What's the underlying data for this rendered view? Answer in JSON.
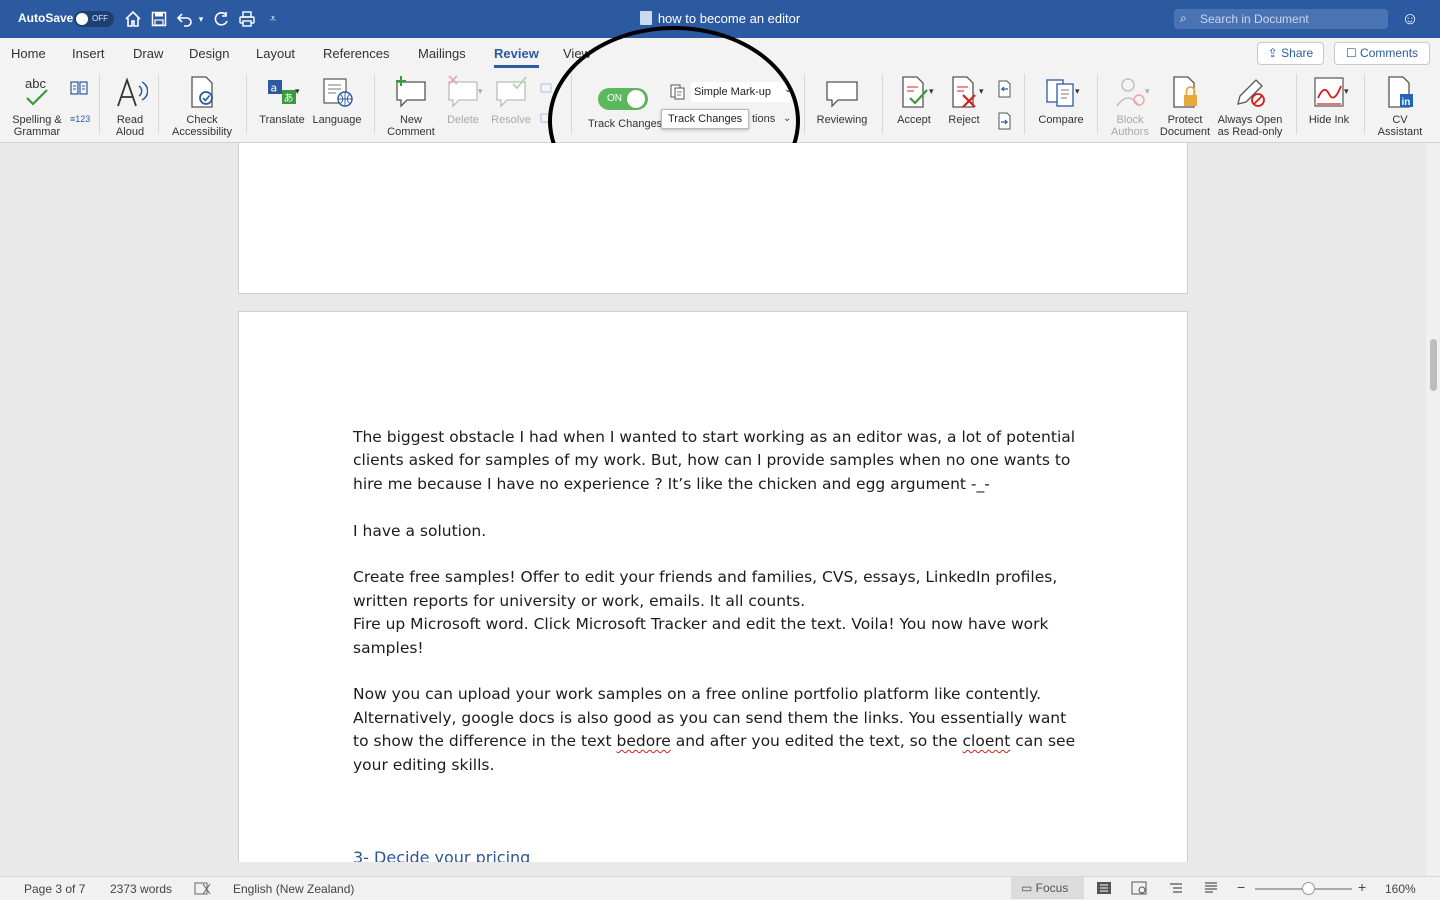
{
  "titlebar": {
    "autosave_label": "AutoSave",
    "autosave_state": "OFF",
    "document_title": "how to become an editor",
    "search_placeholder": "Search in Document"
  },
  "tabs": [
    "Home",
    "Insert",
    "Draw",
    "Design",
    "Layout",
    "References",
    "Mailings",
    "Review",
    "View"
  ],
  "active_tab": "Review",
  "share_label": "Share",
  "comments_label": "Comments",
  "ribbon": {
    "spelling": "Spelling &",
    "spelling2": "Grammar",
    "read": "Read",
    "read2": "Aloud",
    "check": "Check",
    "check2": "Accessibility",
    "translate": "Translate",
    "language": "Language",
    "new": "New",
    "new2": "Comment",
    "delete": "Delete",
    "resolve": "Resolve",
    "track_on": "ON",
    "track_label": "Track Changes",
    "markup_value": "Simple Mark-up",
    "options_fragment": "tions",
    "tooltip": "Track Changes",
    "reviewing": "Reviewing",
    "accept": "Accept",
    "reject": "Reject",
    "compare": "Compare",
    "block": "Block",
    "block2": "Authors",
    "protect": "Protect",
    "protect2": "Document",
    "always": "Always Open",
    "always2": "as Read-only",
    "hide_ink": "Hide Ink",
    "cv": "CV",
    "cv2": "Assistant"
  },
  "document": {
    "paragraphs": [
      "The biggest obstacle I had when I wanted to start working as an editor was, a lot of potential clients asked for samples of my work. But, how can I provide samples when no one wants to hire me because I have no experience ? It’s like the chicken and egg argument -_-",
      "",
      "I have a solution.",
      "",
      "Create free samples! Offer to edit your friends and families, CVS, essays, LinkedIn profiles, written reports for university or work, emails. It all counts.",
      "Fire up Microsoft word. Click Microsoft Tracker and edit the text. Voila! You now have work samples!",
      ""
    ],
    "last_para_part1": "Now you can upload your work samples on a free online portfolio platform like contently. Alternatively, google docs is also good as you can send them the links. You essentially want to show the difference in the text ",
    "last_para_word1": "bedore",
    "last_para_part2": " and after you edited the text, so the ",
    "last_para_word2": "cloent",
    "last_para_part3": " can see your editing skills.",
    "heading": "3- Decide your pricing"
  },
  "status": {
    "page": "Page 3 of 7",
    "words": "2373 words",
    "language": "English (New Zealand)",
    "focus": "Focus",
    "zoom": "160%"
  },
  "colors": {
    "titlebar": "#2c5aa0",
    "accent": "#2c5aa0",
    "toggle_on": "#5cb85c",
    "heading": "#2f5597",
    "spelling_error": "#d4201d"
  }
}
